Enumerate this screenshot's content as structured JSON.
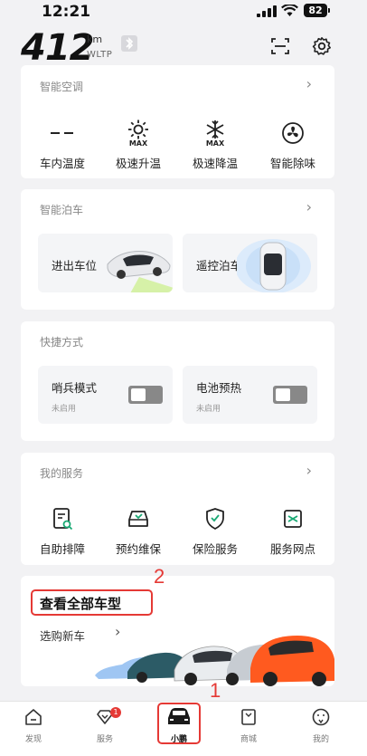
{
  "status_bar": {
    "time": "12:21",
    "battery": "82"
  },
  "header": {
    "range": "412",
    "unit": "km",
    "standard": "WLTP"
  },
  "climate": {
    "title": "智能空调",
    "items": [
      {
        "icon": "temperature-dash-icon",
        "label": "车内温度",
        "badge": ""
      },
      {
        "icon": "sun-icon",
        "label": "极速升温",
        "badge": "MAX"
      },
      {
        "icon": "snowflake-icon",
        "label": "极速降温",
        "badge": "MAX"
      },
      {
        "icon": "fan-icon",
        "label": "智能除味",
        "badge": ""
      }
    ]
  },
  "parking": {
    "title": "智能泊车",
    "items": [
      {
        "label": "进出车位"
      },
      {
        "label": "遥控泊车"
      }
    ]
  },
  "shortcuts": {
    "title": "快捷方式",
    "items": [
      {
        "label": "哨兵模式",
        "status": "未启用"
      },
      {
        "label": "电池预热",
        "status": "未启用"
      }
    ]
  },
  "services": {
    "title": "我的服务",
    "items": [
      {
        "icon": "diagnosis-icon",
        "label": "自助排障"
      },
      {
        "icon": "car-maintenance-icon",
        "label": "预约维保"
      },
      {
        "icon": "shield-check-icon",
        "label": "保险服务"
      },
      {
        "icon": "service-point-icon",
        "label": "服务网点"
      }
    ]
  },
  "promo": {
    "title": "查看全部车型",
    "link": "选购新车"
  },
  "annotations": {
    "one": "1",
    "two": "2"
  },
  "nav": {
    "items": [
      {
        "icon": "home-icon",
        "label": "发现"
      },
      {
        "icon": "heart-service-icon",
        "label": "服务",
        "badge": "1"
      },
      {
        "icon": "car-icon",
        "label": "小鹏",
        "active": true
      },
      {
        "icon": "shop-bag-icon",
        "label": "商城"
      },
      {
        "icon": "profile-face-icon",
        "label": "我的"
      }
    ]
  },
  "colors": {
    "accent_red": "#e53935",
    "promo_car": "#ff5a1f",
    "card_bg": "#ffffff"
  }
}
